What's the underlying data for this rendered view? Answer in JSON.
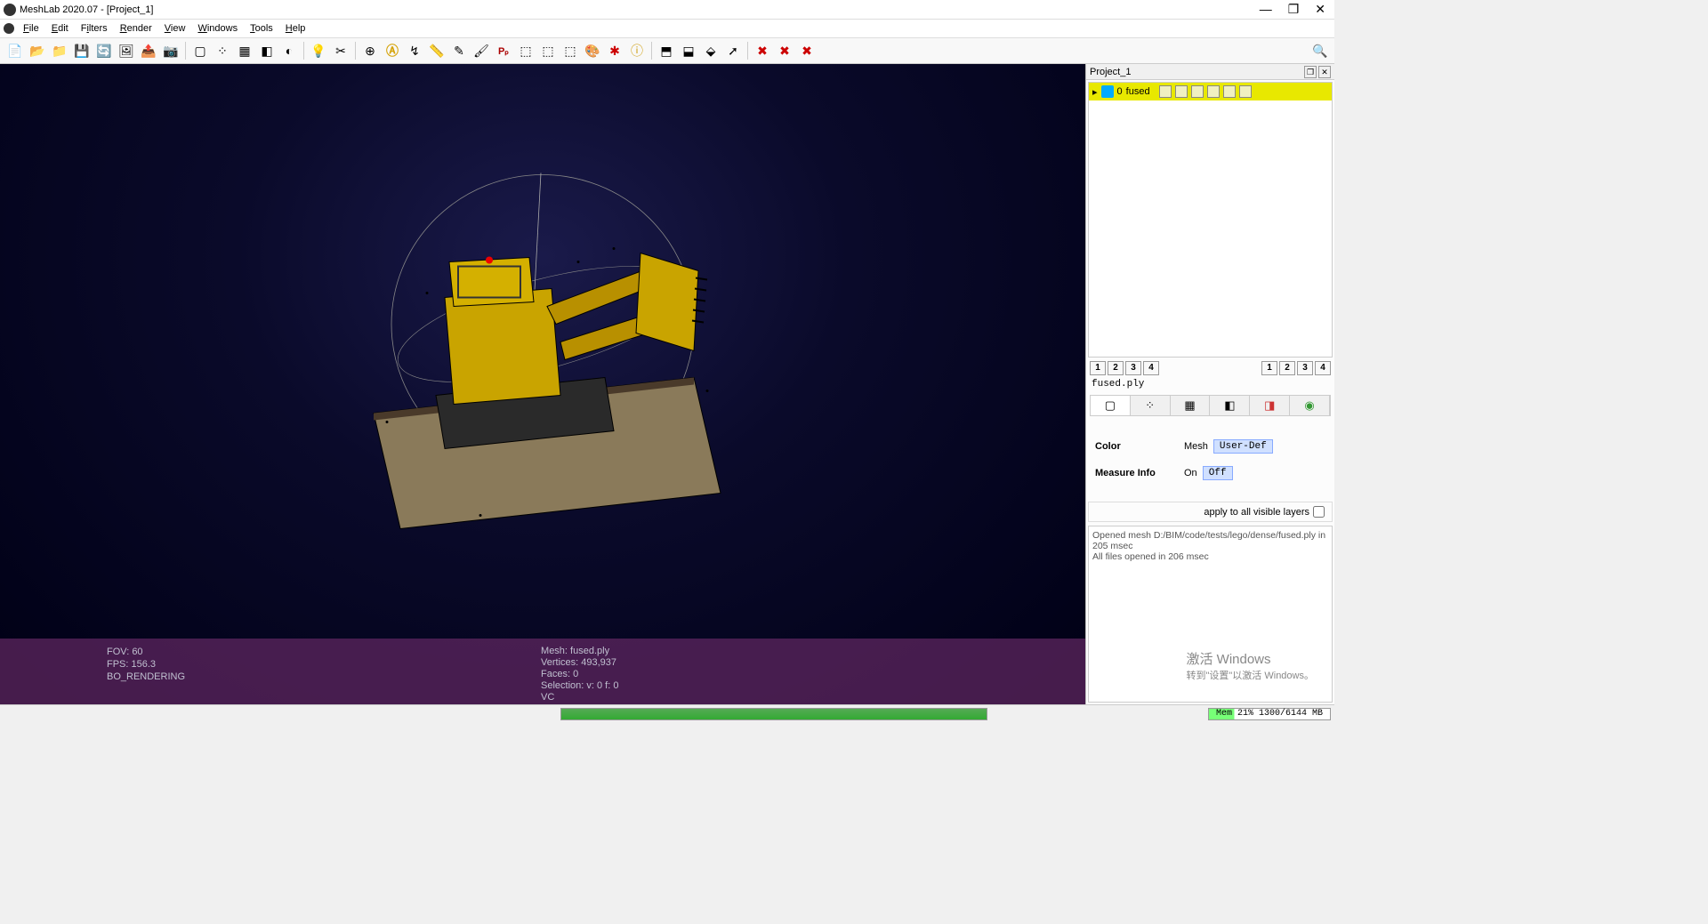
{
  "window": {
    "title": "MeshLab 2020.07 - [Project_1]",
    "minimize": "—",
    "maximize": "❐",
    "close": "✕"
  },
  "menu": {
    "file": "File",
    "edit": "Edit",
    "filters": "Filters",
    "render": "Render",
    "view": "View",
    "windows": "Windows",
    "tools": "Tools",
    "help": "Help"
  },
  "toolbar_icons": [
    "new-project",
    "open-project",
    "open-mesh",
    "save",
    "reload",
    "import-raster",
    "export",
    "snapshot",
    "sep",
    "bbox",
    "points",
    "wire",
    "flat",
    "smooth",
    "texture",
    "sep",
    "light",
    "cull",
    "sep",
    "trackball",
    "atom",
    "axis",
    "measure",
    "sep",
    "pick",
    "paint",
    "pp",
    "sep",
    "sel-all",
    "sel-none",
    "sel-inv",
    "colorize",
    "del",
    "info",
    "sep",
    "align",
    "icp",
    "cam",
    "arrow",
    "sep",
    "del-sel-v",
    "del-sel-f",
    "del-sel-vf"
  ],
  "viewport": {
    "info_left": {
      "fov": "FOV: 60",
      "fps": "FPS: 156.3",
      "rendering": "BO_RENDERING"
    },
    "info_right": {
      "mesh": "Mesh: fused.ply",
      "vertices": "Vertices: 493,937",
      "faces": "Faces: 0",
      "selection": "Selection: v: 0 f: 0",
      "vc": "VC"
    }
  },
  "project_panel": {
    "title": "Project_1",
    "layer": {
      "index": "0",
      "name": "fused"
    },
    "quick_left": [
      "1",
      "2",
      "3",
      "4"
    ],
    "quick_right": [
      "1",
      "2",
      "3",
      "4"
    ],
    "mesh_name": "fused.ply",
    "props": {
      "color_label": "Color",
      "color_sub": "Mesh",
      "color_btn": "User-Def",
      "measure_label": "Measure Info",
      "measure_sub": "On",
      "measure_btn": "Off"
    },
    "apply_label": "apply to all visible layers"
  },
  "log": {
    "line1": "Opened mesh D:/BIM/code/tests/lego/dense/fused.ply in 205 msec",
    "line2": "All files opened in 206 msec"
  },
  "watermark": {
    "line1": "激活 Windows",
    "line2": "转到\"设置\"以激活 Windows。"
  },
  "statusbar": {
    "mem": "Mem 21% 1300/6144 MB"
  }
}
